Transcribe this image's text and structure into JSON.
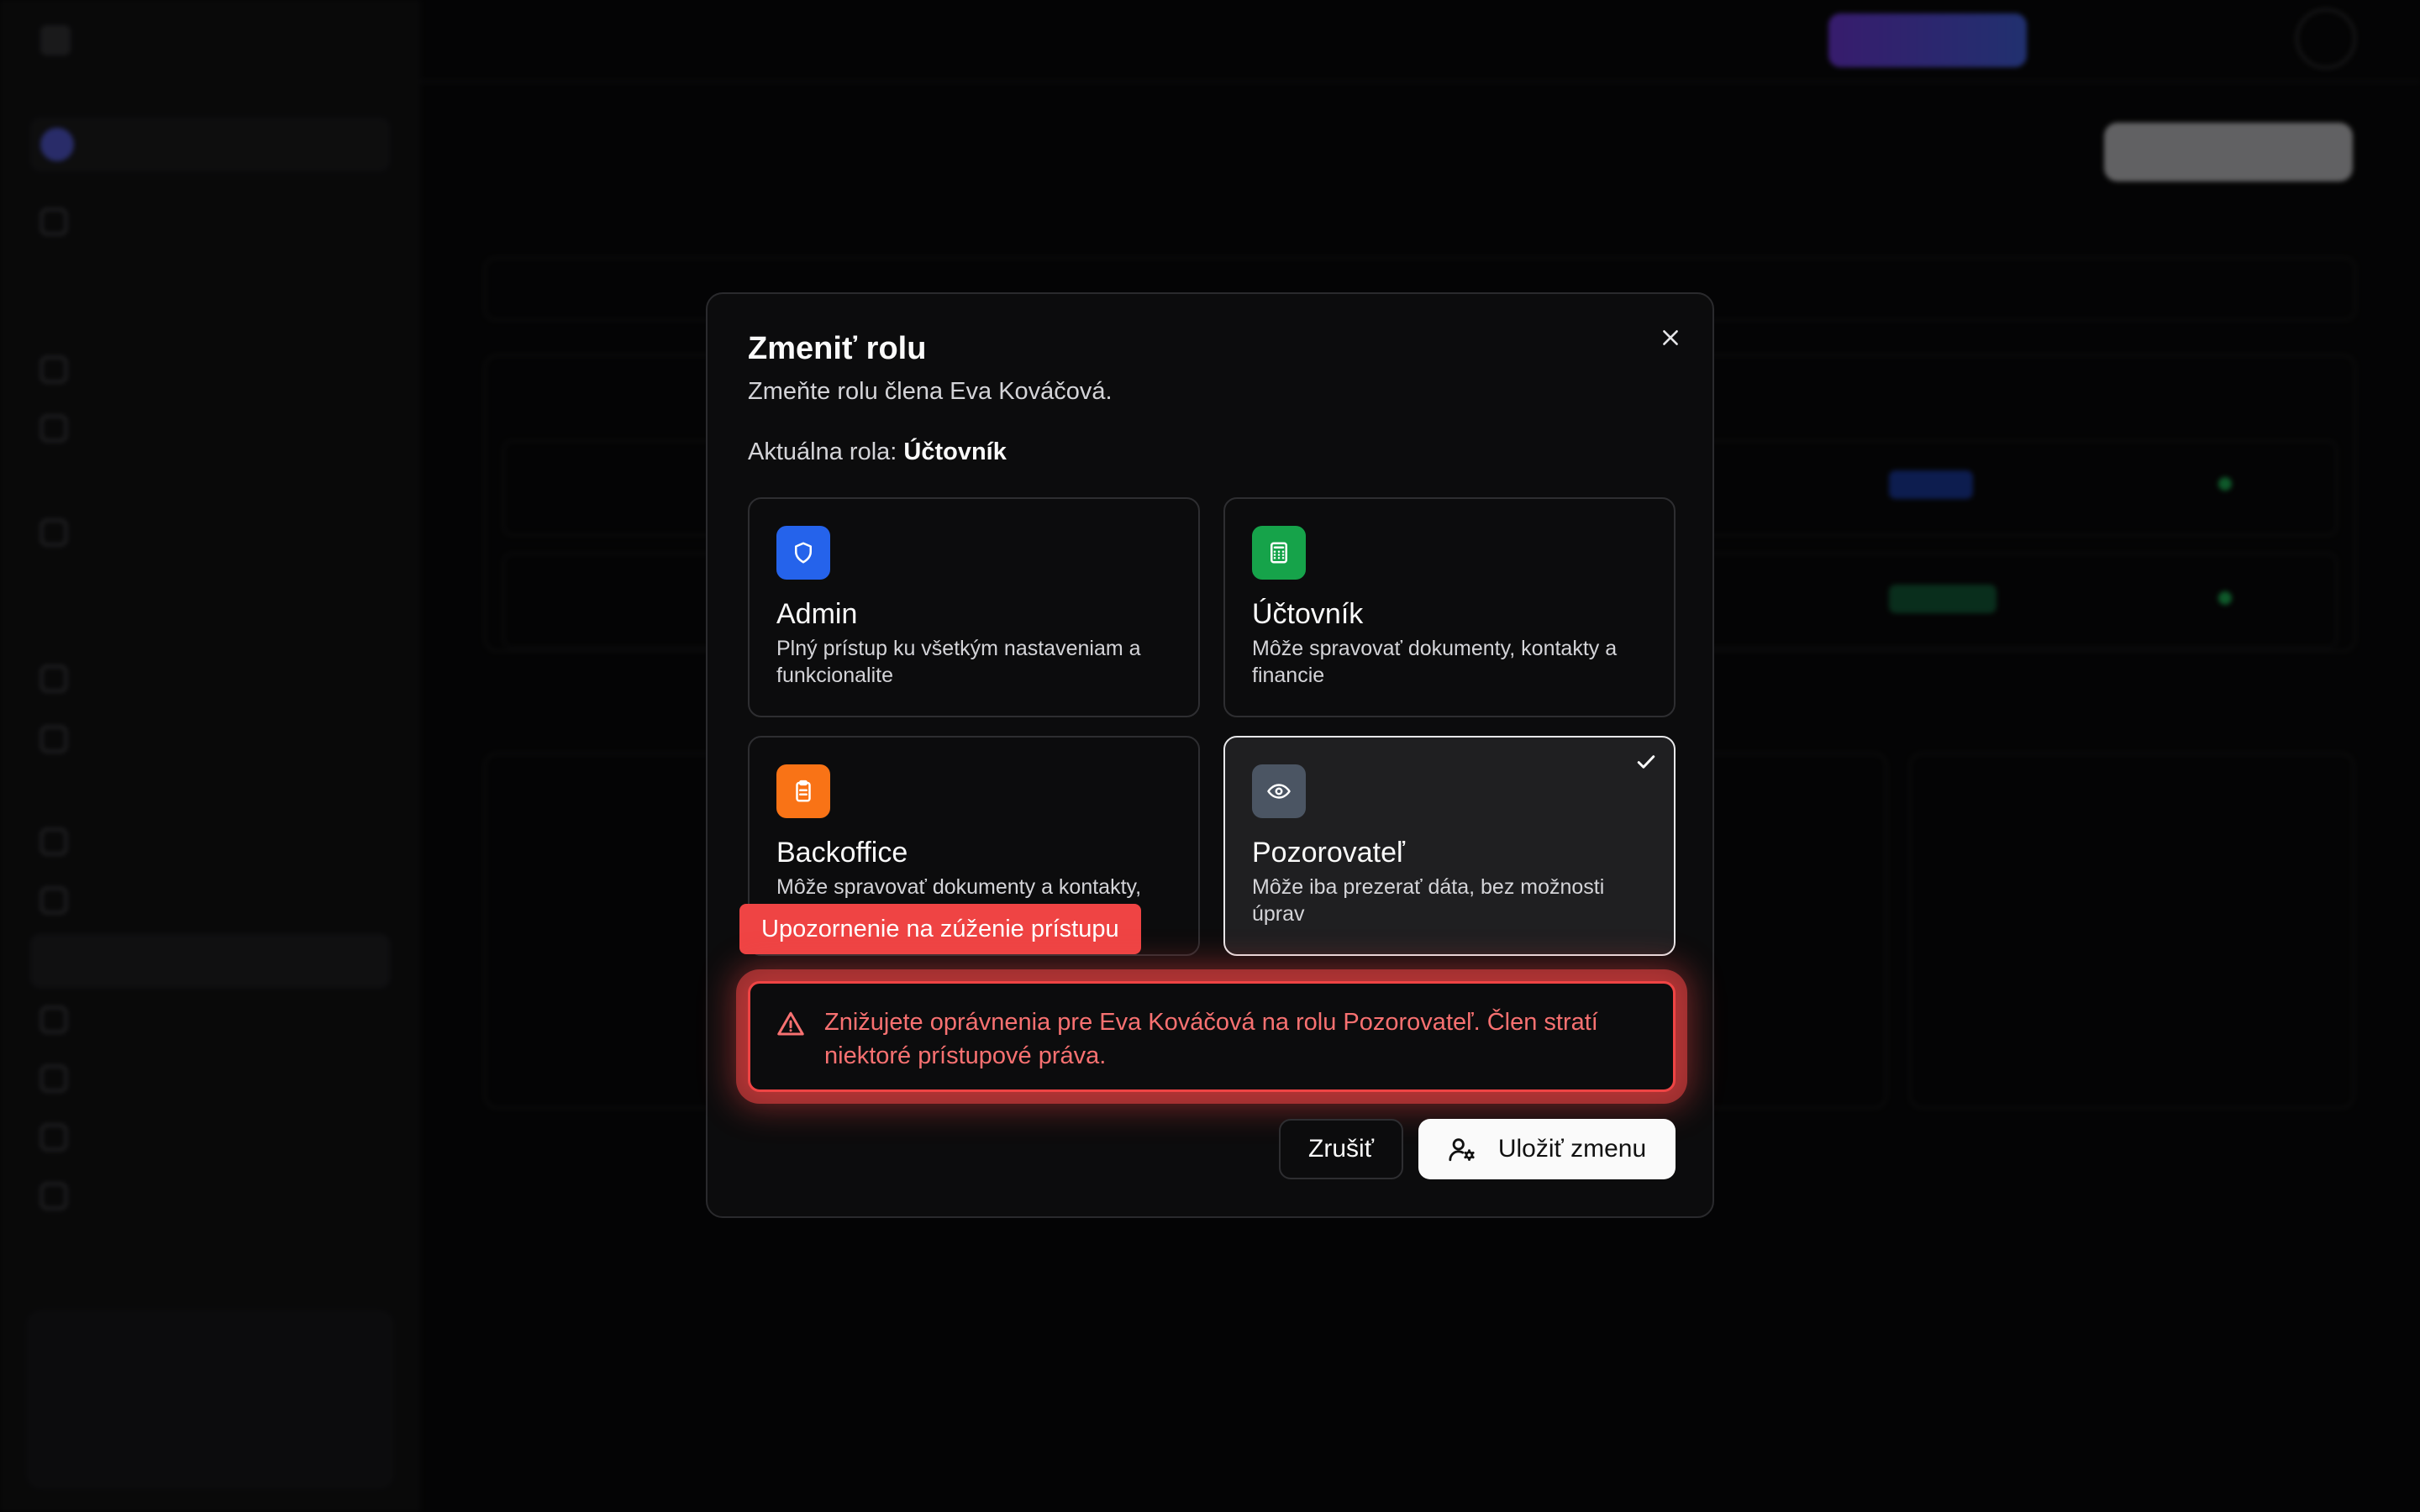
{
  "dialog": {
    "title": "Zmeniť rolu",
    "description": "Zmeňte rolu člena Eva Kováčová.",
    "current_role_label": "Aktuálna rola:",
    "current_role_value": "Účtovník",
    "roles": [
      {
        "name": "Admin",
        "description": "Plný prístup ku všetkým nastaveniam a funkcionalite",
        "color": "#2563eb",
        "icon": "shield-icon"
      },
      {
        "name": "Účtovník",
        "description": "Môže spravovať dokumenty, kontakty a financie",
        "color": "#16a34a",
        "icon": "calculator-icon"
      },
      {
        "name": "Backoffice",
        "description": "Môže spravovať dokumenty a kontakty,",
        "color": "#f97316",
        "icon": "clipboard-icon"
      },
      {
        "name": "Pozorovateľ",
        "description": "Môže iba prezerať dáta, bez možnosti úprav",
        "color": "#4b5563",
        "icon": "eye-icon",
        "selected": true
      }
    ],
    "warning_tag": "Upozornenie na zúženie prístupu",
    "warning_text": "Znižujete oprávnenia pre Eva Kováčová na rolu Pozorovateľ. Člen stratí niektoré prístupové práva.",
    "cancel_label": "Zrušiť",
    "save_label": "Uložiť zmenu"
  },
  "colors": {
    "warning": "#ef4444",
    "warning_text": "#f87171"
  }
}
